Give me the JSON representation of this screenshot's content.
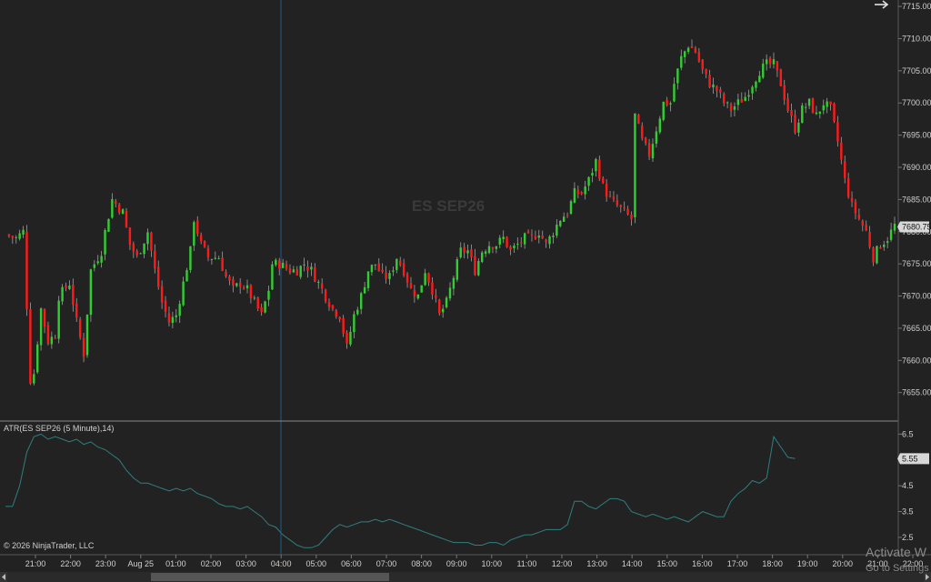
{
  "instrument_watermark": "ES SEP26",
  "indicator_label": "ATR(ES SEP26 (5 Minute),14)",
  "copyright": "© 2026 NinjaTrader, LLC",
  "windows_notice": {
    "line1": "Activate W",
    "line2": "Go to Settings"
  },
  "icons": {
    "nav_arrow": "right-arrow-icon",
    "scroll_left": "scroll-left-arrow-icon",
    "scroll_right": "scroll-right-arrow-icon"
  },
  "colors": {
    "background": "#222222",
    "up_candle": "#32cd32",
    "down_candle": "#ff1a1a",
    "wick": "#a0a0a0",
    "atr_line": "#2f7f7f",
    "crosshair": "#1e5a8a",
    "axis_text": "#d0d0d0",
    "price_box": "#d8d8d8"
  },
  "chart_data": [
    {
      "type": "candlestick",
      "title": "ES SEP26",
      "y_range": [
        7651,
        7716
      ],
      "y_ticks": [
        "7655.00",
        "7660.00",
        "7665.00",
        "7670.00",
        "7675.00",
        "7680.00",
        "7685.00",
        "7690.00",
        "7695.00",
        "7700.00",
        "7705.00",
        "7710.00",
        "7715.00"
      ],
      "last_price": "7680.75",
      "x_ticks": [
        "21:00",
        "22:00",
        "23:00",
        "Aug 25",
        "01:00",
        "02:00",
        "03:00",
        "04:00",
        "05:00",
        "06:00",
        "07:00",
        "08:00",
        "09:00",
        "10:00",
        "11:00",
        "12:00",
        "13:00",
        "14:00",
        "15:00",
        "16:00",
        "17:00",
        "18:00",
        "19:00",
        "20:00",
        "21:00",
        "22:00"
      ],
      "price_path": [
        [
          0,
          7679.5
        ],
        [
          3,
          7679
        ],
        [
          5,
          7680
        ],
        [
          7,
          7657
        ],
        [
          8,
          7658
        ],
        [
          10,
          7668
        ],
        [
          12,
          7663
        ],
        [
          14,
          7664
        ],
        [
          15,
          7670
        ],
        [
          18,
          7672
        ],
        [
          20,
          7666
        ],
        [
          22,
          7661
        ],
        [
          24,
          7674
        ],
        [
          27,
          7677
        ],
        [
          28,
          7680
        ],
        [
          30,
          7685
        ],
        [
          33,
          7683
        ],
        [
          35,
          7678
        ],
        [
          37,
          7676
        ],
        [
          40,
          7680
        ],
        [
          42,
          7674
        ],
        [
          44,
          7669
        ],
        [
          46,
          7666
        ],
        [
          48,
          7667
        ],
        [
          50,
          7672
        ],
        [
          52,
          7677
        ],
        [
          53,
          7682
        ],
        [
          55,
          7678
        ],
        [
          57,
          7676
        ],
        [
          60,
          7676
        ],
        [
          62,
          7673
        ],
        [
          64,
          7671
        ],
        [
          66,
          7672
        ],
        [
          68,
          7671
        ],
        [
          70,
          7669
        ],
        [
          72,
          7667
        ],
        [
          74,
          7671
        ],
        [
          75,
          7675
        ],
        [
          77,
          7675
        ],
        [
          80,
          7674
        ],
        [
          82,
          7674
        ],
        [
          84,
          7675
        ],
        [
          86,
          7674
        ],
        [
          88,
          7672
        ],
        [
          90,
          7670
        ],
        [
          92,
          7668
        ],
        [
          94,
          7667
        ],
        [
          96,
          7662
        ],
        [
          98,
          7667
        ],
        [
          100,
          7670
        ],
        [
          102,
          7674
        ],
        [
          104,
          7675
        ],
        [
          106,
          7673
        ],
        [
          108,
          7673
        ],
        [
          110,
          7676
        ],
        [
          112,
          7674
        ],
        [
          114,
          7671
        ],
        [
          116,
          7670
        ],
        [
          118,
          7674
        ],
        [
          120,
          7671
        ],
        [
          122,
          7667
        ],
        [
          124,
          7669
        ],
        [
          126,
          7673
        ],
        [
          128,
          7677
        ],
        [
          130,
          7677
        ],
        [
          132,
          7674
        ],
        [
          134,
          7677
        ],
        [
          136,
          7678
        ],
        [
          138,
          7678
        ],
        [
          140,
          7679
        ],
        [
          142,
          7677
        ],
        [
          144,
          7678
        ],
        [
          146,
          7679
        ],
        [
          148,
          7679
        ],
        [
          150,
          7680
        ],
        [
          152,
          7678
        ],
        [
          154,
          7680
        ],
        [
          156,
          7682
        ],
        [
          158,
          7683
        ],
        [
          160,
          7686
        ],
        [
          162,
          7686
        ],
        [
          164,
          7688
        ],
        [
          166,
          7691
        ],
        [
          168,
          7687
        ],
        [
          170,
          7685
        ],
        [
          172,
          7684
        ],
        [
          174,
          7683
        ],
        [
          176,
          7682
        ],
        [
          177,
          7698
        ],
        [
          179,
          7694
        ],
        [
          181,
          7692
        ],
        [
          183,
          7696
        ],
        [
          185,
          7700
        ],
        [
          187,
          7700
        ],
        [
          188,
          7703
        ],
        [
          190,
          7707
        ],
        [
          192,
          7709
        ],
        [
          194,
          7708
        ],
        [
          196,
          7705
        ],
        [
          198,
          7703
        ],
        [
          200,
          7702
        ],
        [
          202,
          7700
        ],
        [
          204,
          7699
        ],
        [
          206,
          7700
        ],
        [
          208,
          7701
        ],
        [
          210,
          7703
        ],
        [
          212,
          7705
        ],
        [
          214,
          7706
        ],
        [
          216,
          7706
        ],
        [
          218,
          7703
        ],
        [
          220,
          7699
        ],
        [
          222,
          7696
        ],
        [
          224,
          7699
        ],
        [
          226,
          7700
        ],
        [
          228,
          7698
        ],
        [
          230,
          7700
        ],
        [
          232,
          7699
        ],
        [
          234,
          7694
        ],
        [
          236,
          7688
        ],
        [
          238,
          7684
        ],
        [
          240,
          7682
        ],
        [
          242,
          7680
        ],
        [
          244,
          7676
        ],
        [
          246,
          7678
        ],
        [
          248,
          7679
        ],
        [
          250,
          7681
        ]
      ]
    },
    {
      "type": "line",
      "title": "ATR(ES SEP26 (5 Minute),14)",
      "y_range": [
        1.9,
        6.9
      ],
      "y_ticks": [
        "2.5",
        "3.5",
        "4.5",
        "5.5",
        "6.5"
      ],
      "last_value": "5.55",
      "x": [
        0,
        2,
        4,
        6,
        8,
        10,
        12,
        14,
        16,
        18,
        20,
        22,
        24,
        26,
        28,
        30,
        32,
        34,
        36,
        38,
        40,
        42,
        44,
        46,
        48,
        50,
        52,
        54,
        56,
        58,
        60,
        62,
        64,
        66,
        68,
        70,
        72,
        74,
        76,
        78,
        80,
        82,
        84,
        86,
        88,
        90,
        92,
        94,
        96,
        98,
        100,
        102,
        104,
        106,
        108,
        110,
        112,
        114,
        116,
        118,
        120,
        122,
        124,
        126,
        128,
        130,
        132,
        134,
        136,
        138,
        140,
        142,
        144,
        146,
        148,
        150,
        152,
        154,
        156,
        158,
        160,
        162,
        164,
        166,
        168,
        170,
        172,
        174,
        176,
        178,
        180,
        182,
        184,
        186,
        188,
        190,
        192,
        194,
        196,
        198,
        200,
        202,
        204,
        206,
        208,
        210,
        212,
        214,
        216,
        218,
        220,
        222,
        224,
        226,
        228,
        230,
        232,
        234,
        236,
        238,
        240,
        242,
        244,
        246,
        248,
        250
      ],
      "values": [
        3.7,
        3.7,
        4.5,
        5.8,
        6.4,
        6.5,
        6.3,
        6.4,
        6.3,
        6.2,
        6.3,
        6.1,
        6.2,
        6.0,
        5.9,
        5.7,
        5.5,
        5.1,
        4.8,
        4.6,
        4.6,
        4.5,
        4.4,
        4.3,
        4.4,
        4.3,
        4.4,
        4.2,
        4.1,
        4.0,
        3.8,
        3.7,
        3.7,
        3.6,
        3.7,
        3.5,
        3.3,
        3.0,
        2.9,
        2.6,
        2.4,
        2.2,
        2.1,
        2.1,
        2.2,
        2.5,
        2.8,
        3.0,
        2.9,
        3.0,
        3.1,
        3.1,
        3.2,
        3.1,
        3.2,
        3.1,
        3.0,
        2.9,
        2.8,
        2.7,
        2.6,
        2.5,
        2.4,
        2.3,
        2.3,
        2.3,
        2.2,
        2.2,
        2.3,
        2.3,
        2.2,
        2.4,
        2.5,
        2.6,
        2.6,
        2.7,
        2.8,
        2.8,
        2.8,
        3.0,
        3.9,
        3.9,
        3.7,
        3.6,
        3.8,
        4.0,
        4.0,
        3.9,
        3.5,
        3.4,
        3.3,
        3.4,
        3.3,
        3.2,
        3.3,
        3.2,
        3.1,
        3.3,
        3.5,
        3.4,
        3.3,
        3.3,
        3.9,
        4.2,
        4.4,
        4.7,
        4.6,
        4.8,
        6.4,
        6.0,
        5.6,
        5.55
      ]
    }
  ]
}
